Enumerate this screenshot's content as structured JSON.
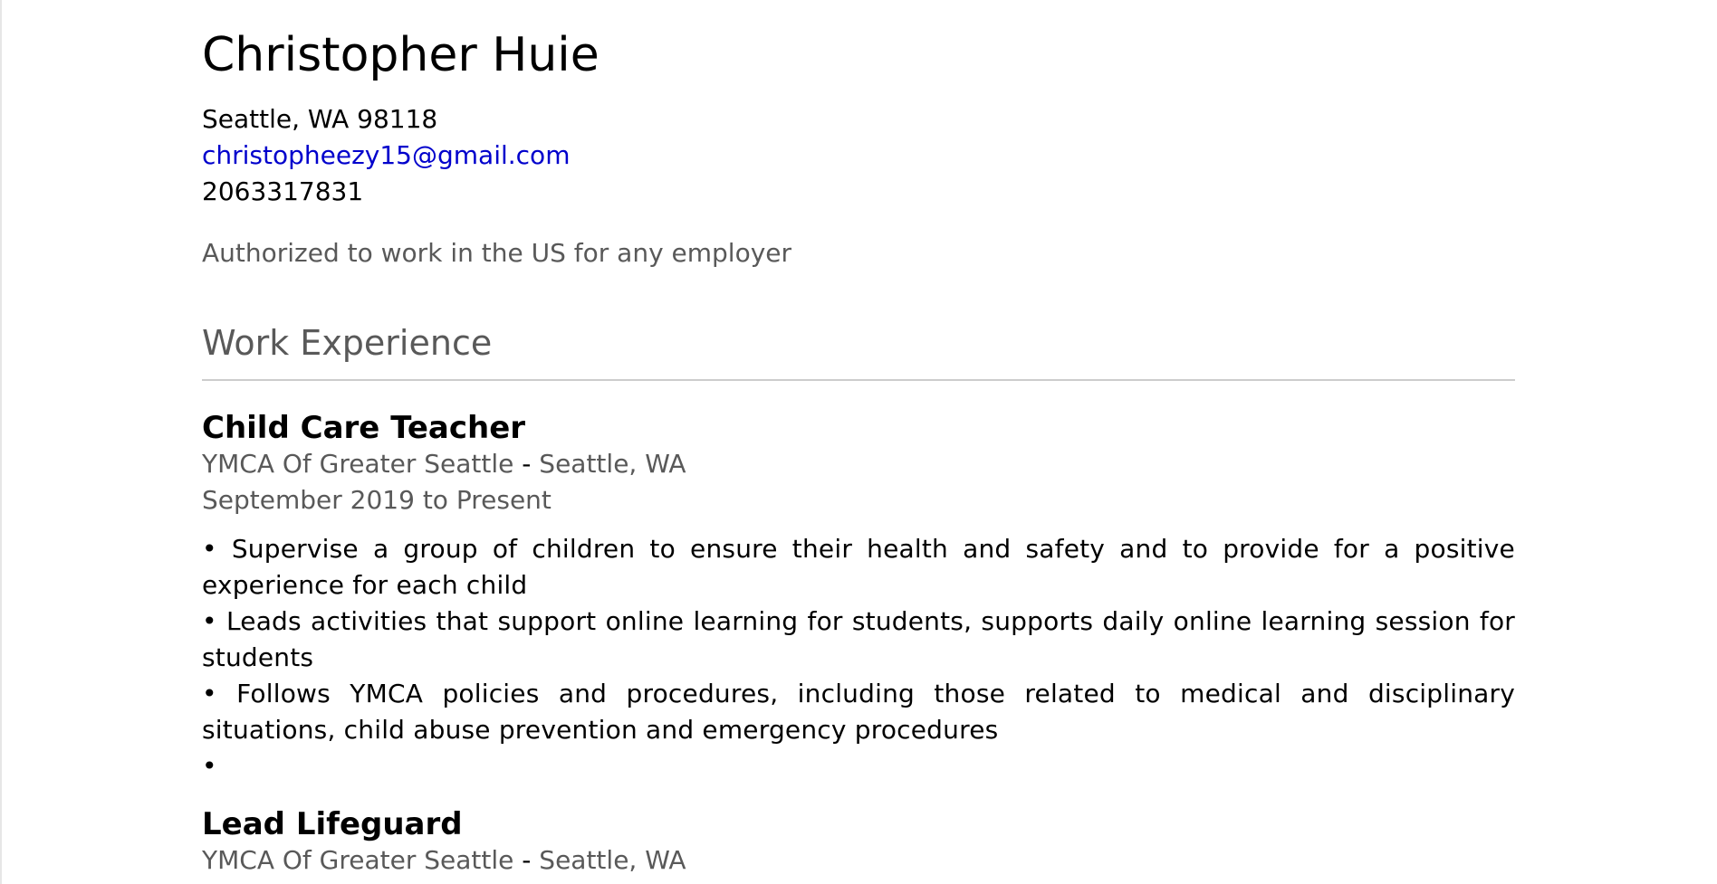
{
  "resume": {
    "name": "Christopher Huie",
    "location": "Seattle, WA 98118",
    "email": "christopheezy15@gmail.com",
    "phone": "2063317831",
    "authorization": "Authorized to work in the US for any employer",
    "sections": {
      "work_experience_title": "Work Experience"
    },
    "jobs": [
      {
        "title": "Child Care Teacher",
        "company": "YMCA Of Greater Seattle",
        "separator": " - ",
        "location": "Seattle, WA",
        "dates": "September 2019 to Present",
        "duties": [
          "• Supervise a group of children to ensure their health and safety and to provide for a positive experience for each child",
          "• Leads activities that support online learning for students, supports daily online learning session for students",
          "• Follows YMCA policies and procedures, including those related to medical and disciplinary situations, child abuse prevention and emergency procedures",
          "•"
        ]
      },
      {
        "title": "Lead Lifeguard",
        "company": "YMCA Of Greater Seattle",
        "separator": " - ",
        "location": "Seattle, WA"
      }
    ]
  }
}
